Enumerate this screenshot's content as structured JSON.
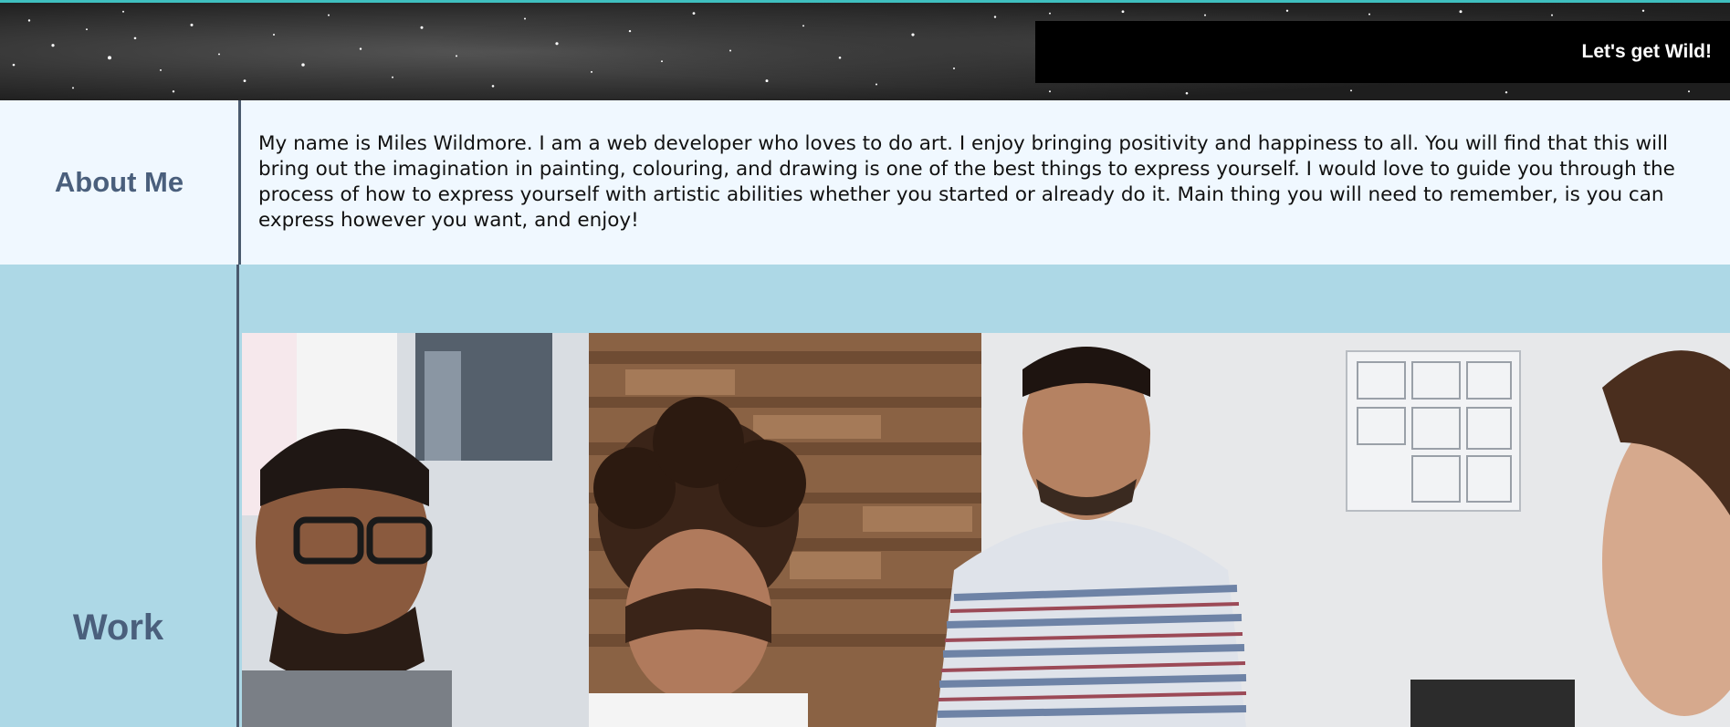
{
  "header": {
    "tagline": "Let's get Wild!"
  },
  "about": {
    "title": "About Me",
    "text": "My name is Miles Wildmore. I am a web developer who loves to do art. I enjoy bringing positivity and happiness to all. You will find that this will bring out the imagination in painting, colouring, and drawing is one of the best things to express yourself. I would love to guide you through the process of how to express yourself with artistic abilities whether you started or already do it. Main thing you will need to remember, is you can express however you want, and enjoy!"
  },
  "work": {
    "title": "Work",
    "photo_icon": "team-meeting-photo"
  },
  "colors": {
    "header_accent": "#3fbfbf",
    "about_bg": "#f0f8ff",
    "work_bg": "#add8e6",
    "title_color": "#4a5f7c"
  }
}
